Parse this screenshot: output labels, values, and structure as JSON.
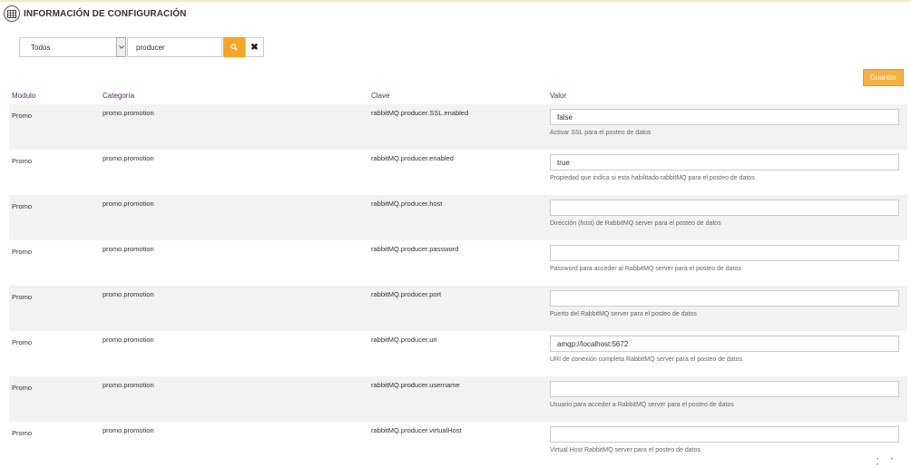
{
  "header": {
    "title": "INFORMACIÓN DE CONFIGURACIÓN",
    "icon": "table-icon"
  },
  "filters": {
    "module_select": "Todos",
    "search_value": "producer",
    "search_icon": "search-icon",
    "clear_icon": "close-icon",
    "clear_glyph": "✖"
  },
  "actions": {
    "save_label": "Guardar"
  },
  "colors": {
    "accent": "#f5a623",
    "header_text": "#5a2d66",
    "row_alt": "#f2f2f2"
  },
  "table": {
    "headers": [
      "Modulo",
      "Categoría",
      "Clave",
      "Valor"
    ],
    "rows": [
      {
        "module": "Promo",
        "category": "promo.promotion",
        "key": "rabbitMQ.producer.SSL.enabled",
        "value": "false",
        "description": "Activar SSL para el posteo de datos"
      },
      {
        "module": "Promo",
        "category": "promo.promotion",
        "key": "rabbitMQ.producer.enabled",
        "value": "true",
        "description": "Propiedad que indica si esta habilitado rabbitMQ para el posteo de datos"
      },
      {
        "module": "Promo",
        "category": "promo.promotion",
        "key": "rabbitMQ.producer.host",
        "value": "",
        "description": "Dirección (host) de RabbitMQ server para el posteo de datos"
      },
      {
        "module": "Promo",
        "category": "promo.promotion",
        "key": "rabbitMQ.producer.password",
        "value": "",
        "description": "Password para acceder al RabbitMQ server para el posteo de datos"
      },
      {
        "module": "Promo",
        "category": "promo.promotion",
        "key": "rabbitMQ.producer.port",
        "value": "",
        "description": "Puerto del RabbitMQ server para el posteo de datos"
      },
      {
        "module": "Promo",
        "category": "promo.promotion",
        "key": "rabbitMQ.producer.uri",
        "value": "amqp://localhost:5672",
        "description": "URI de conexión completa RabbitMQ server para el posteo de datos"
      },
      {
        "module": "Promo",
        "category": "promo.promotion",
        "key": "rabbitMQ.producer.username",
        "value": "",
        "description": "Usuario para acceder a RabbitMQ server para el posteo de datos"
      },
      {
        "module": "Promo",
        "category": "promo.promotion",
        "key": "rabbitMQ.producer.virtualHost",
        "value": "",
        "description": "Virtual Host RabbitMQ server para el posteo de datos"
      }
    ]
  }
}
